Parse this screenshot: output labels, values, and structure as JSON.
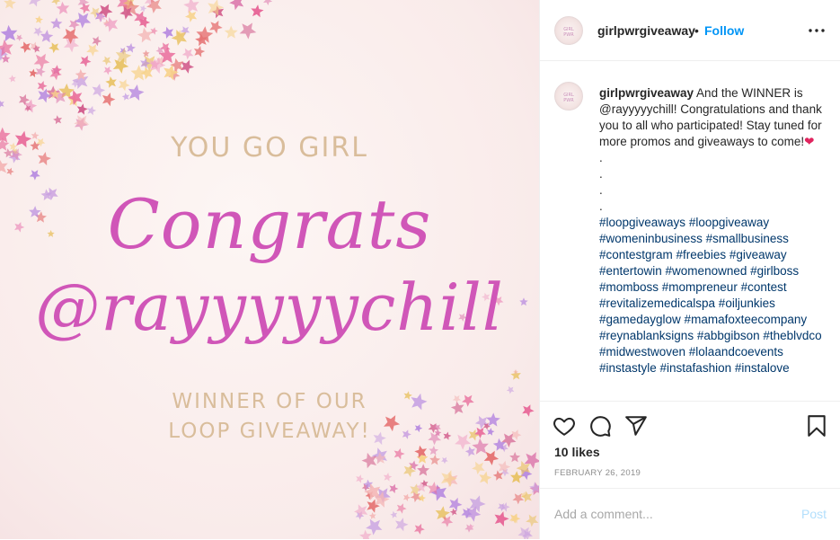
{
  "post_image": {
    "line_top": "YOU GO GIRL",
    "line_script_1": "Congrats",
    "line_script_2": "@rayyyyychill",
    "line_bottom_1": "WINNER OF OUR",
    "line_bottom_2": "LOOP GIVEAWAY!",
    "colors": {
      "script": "#d056b8",
      "gold": "#d9bd9b",
      "background": "#f9ebea"
    }
  },
  "header": {
    "username": "girlpwrgiveaway",
    "separator": "•",
    "follow_label": "Follow",
    "more_icon": "more-horizontal-icon",
    "avatar_text": "GIRL PWR"
  },
  "caption": {
    "username": "girlpwrgiveaway",
    "text": " And the WINNER is @rayyyyychill! Congratulations and thank you to all who participated! Stay tuned for more promos and giveaways to come!",
    "emoji": "❤",
    "dots": [
      ".",
      ".",
      ".",
      "."
    ],
    "hashtags": "#loopgiveaways #loopgiveaway #womeninbusiness #smallbusiness #contestgram #freebies #giveaway #entertowin #womenowned #girlboss #momboss #mompreneur #contest #revitalizemedicalspa #oiljunkies #gamedayglow #mamafoxteecompany #reynablanksigns #abbgibson #theblvdco #midwestwoven #lolaandcoevents #instastyle #instafashion #instalove"
  },
  "actions": {
    "icons": [
      "heart-icon",
      "comment-icon",
      "share-icon",
      "bookmark-icon"
    ],
    "likes": "10 likes",
    "date": "FEBRUARY 26, 2019"
  },
  "comment_box": {
    "placeholder": "Add a comment...",
    "post_label": "Post"
  },
  "colors": {
    "link": "#0095f6",
    "hashtag": "#00376b",
    "post_disabled": "#b2dffc"
  }
}
